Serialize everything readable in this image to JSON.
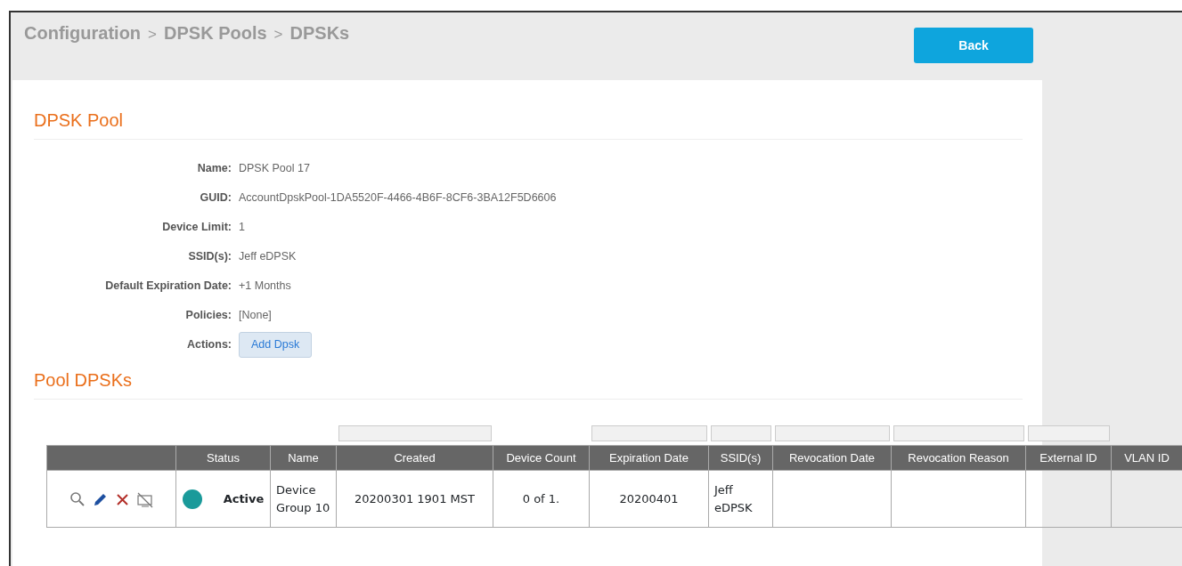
{
  "breadcrumb": [
    "Configuration",
    "DPSK Pools",
    "DPSKs"
  ],
  "breadcrumb_separator": ">",
  "back_button": "Back",
  "pool_section": {
    "title": "DPSK Pool",
    "fields": [
      {
        "label": "Name:",
        "value": "DPSK Pool 17"
      },
      {
        "label": "GUID:",
        "value": "AccountDpskPool-1DA5520F-4466-4B6F-8CF6-3BA12F5D6606"
      },
      {
        "label": "Device Limit:",
        "value": "1"
      },
      {
        "label": "SSID(s):",
        "value": "Jeff eDPSK"
      },
      {
        "label": "Default Expiration Date:",
        "value": "+1 Months"
      },
      {
        "label": "Policies:",
        "value": "[None]"
      }
    ],
    "actions_label": "Actions:",
    "action_button": "Add Dpsk"
  },
  "table_section": {
    "title": "Pool DPSKs",
    "columns": [
      {
        "filter": false
      },
      {
        "label": "Status",
        "filter": false
      },
      {
        "label": "Name",
        "filter": false
      },
      {
        "label": "Created",
        "filter": true
      },
      {
        "label": "Device Count",
        "filter": false
      },
      {
        "label": "Expiration Date",
        "filter": true
      },
      {
        "label": "SSID(s)",
        "filter": true
      },
      {
        "label": "Revocation Date",
        "filter": true
      },
      {
        "label": "Revocation Reason",
        "filter": true
      },
      {
        "label": "External ID",
        "filter": true
      },
      {
        "label": "VLAN ID",
        "filter": false
      }
    ],
    "rows": [
      {
        "status": {
          "label": "Active",
          "color": "#1a9a9a"
        },
        "name": "Device Group 10",
        "created": "20200301 1901 MST",
        "device_count": "0 of 1.",
        "expiration_date": "20200401",
        "ssids": "Jeff eDPSK"
      }
    ]
  }
}
